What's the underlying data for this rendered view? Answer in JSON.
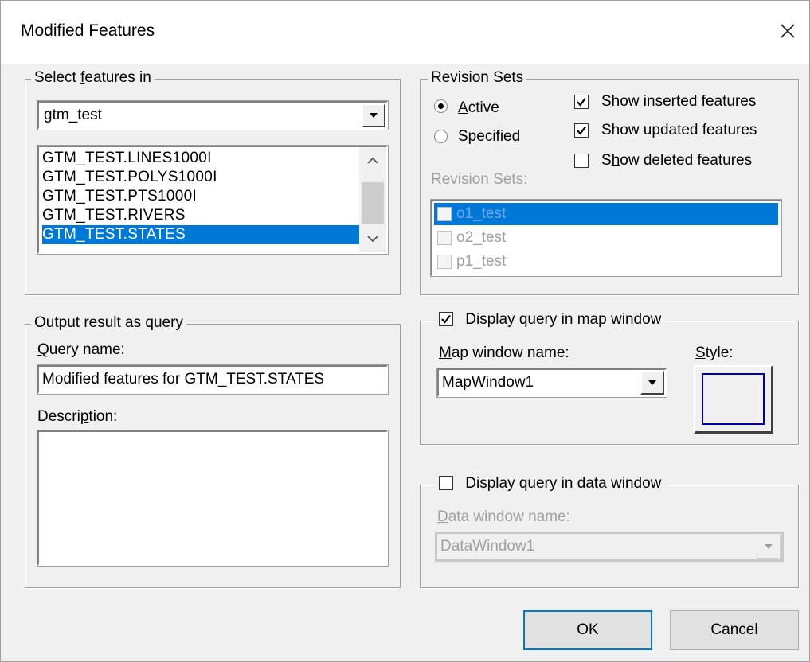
{
  "window": {
    "title": "Modified Features"
  },
  "select_features": {
    "legend_pre": "Select ",
    "legend_u": "f",
    "legend_post": "eatures in",
    "schema_value": "gtm_test",
    "items": [
      {
        "label": "GTM_TEST.LINES1000I",
        "selected": false
      },
      {
        "label": "GTM_TEST.POLYS1000I",
        "selected": false
      },
      {
        "label": "GTM_TEST.PTS1000I",
        "selected": false
      },
      {
        "label": "GTM_TEST.RIVERS",
        "selected": false
      },
      {
        "label": "GTM_TEST.STATES",
        "selected": true
      }
    ]
  },
  "revision_sets": {
    "legend": "Revision Sets",
    "radio_active_u": "A",
    "radio_active_rest": "ctive",
    "radio_specified_pre": "Sp",
    "radio_specified_u": "e",
    "radio_specified_post": "cified",
    "selected_radio": "active",
    "show_inserted": {
      "pre": "Show inserted features",
      "checked": true
    },
    "show_updated": {
      "pre": "Show updated features",
      "checked": true
    },
    "show_deleted": {
      "u": "h",
      "pre": "S",
      "post": "ow deleted features",
      "checked": false
    },
    "list_label_u": "R",
    "list_label_rest": "evision Sets:",
    "items": [
      {
        "label": "o1_test",
        "selected": true
      },
      {
        "label": "o2_test",
        "selected": false
      },
      {
        "label": "p1_test",
        "selected": false
      }
    ]
  },
  "output_query": {
    "legend": "Output result as query",
    "query_name_u": "Q",
    "query_name_rest": "uery name:",
    "query_name_value": "Modified features for GTM_TEST.STATES",
    "description_pre": "Descri",
    "description_u": "p",
    "description_post": "tion:",
    "description_value": ""
  },
  "map_window": {
    "checkbox_pre": "Display query in map ",
    "checkbox_u": "w",
    "checkbox_post": "indow",
    "checked": true,
    "name_label_u": "M",
    "name_label_rest": "ap window name:",
    "name_value": "MapWindow1",
    "style_label_u": "S",
    "style_label_rest": "tyle:"
  },
  "data_window": {
    "checkbox_pre": "Display query in d",
    "checkbox_u": "a",
    "checkbox_post": "ta window",
    "checked": false,
    "name_label_u": "D",
    "name_label_rest": "ata window name:",
    "name_value": "DataWindow1"
  },
  "buttons": {
    "ok": "OK",
    "cancel": "Cancel"
  },
  "colors": {
    "selection": "#0078d7",
    "default_button_border": "#0078d7",
    "style_swatch": "#0000a8"
  }
}
